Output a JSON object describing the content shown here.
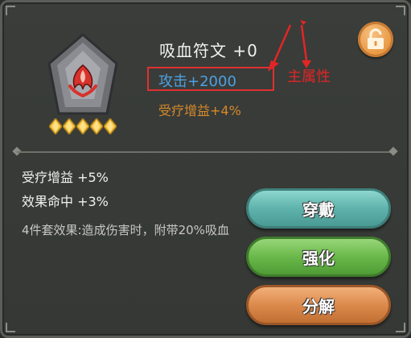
{
  "rune": {
    "name": "吸血符文 +0",
    "main_attribute": "攻击+2000",
    "sub_main_attribute": "受疗增益+4%",
    "star_count": 5
  },
  "annotation": {
    "label": "主属性",
    "color": "#e32525"
  },
  "stats": [
    {
      "text": "受疗增益 +5%"
    },
    {
      "text": "效果命中 +3%"
    }
  ],
  "set_effect": "4件套效果:造成伤害时，附带20%吸血",
  "buttons": {
    "wear": "穿戴",
    "strengthen": "强化",
    "decompose": "分解"
  },
  "icons": {
    "lock": "unlock-icon",
    "rune": "rune-icon",
    "star": "star-icon"
  }
}
